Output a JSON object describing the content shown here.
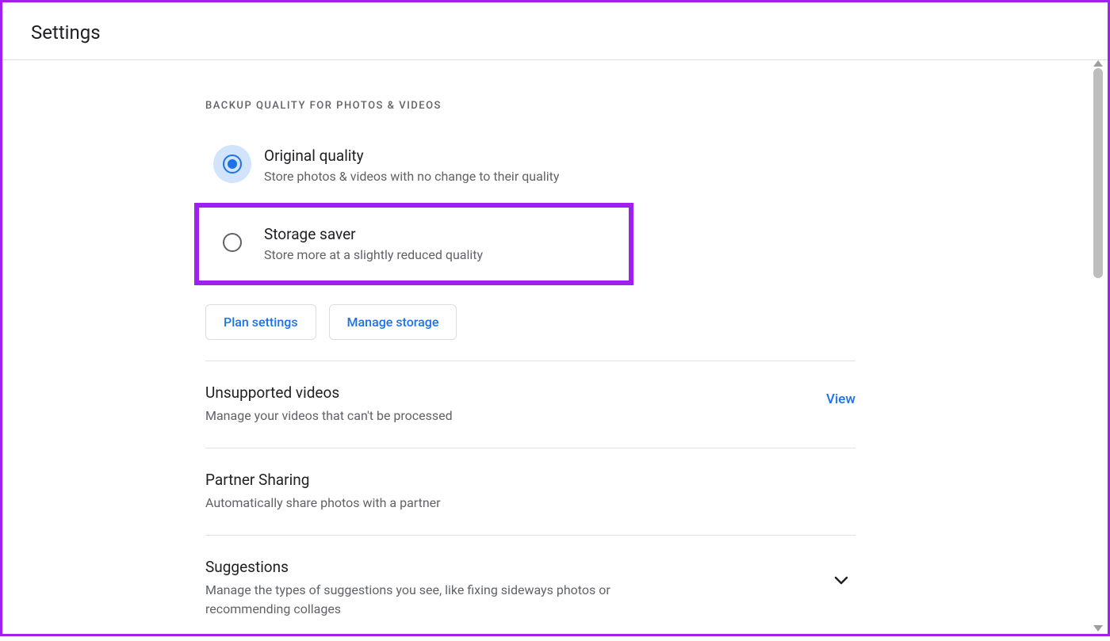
{
  "header": {
    "title": "Settings"
  },
  "backup_quality": {
    "section_label": "BACKUP QUALITY FOR PHOTOS & VIDEOS",
    "options": [
      {
        "title": "Original quality",
        "desc": "Store photos & videos with no change to their quality",
        "selected": true,
        "highlighted": false
      },
      {
        "title": "Storage saver",
        "desc": "Store more at a slightly reduced quality",
        "selected": false,
        "highlighted": true
      }
    ],
    "buttons": {
      "plan": "Plan settings",
      "manage": "Manage storage"
    }
  },
  "sections": {
    "unsupported": {
      "title": "Unsupported videos",
      "desc": "Manage your videos that can't be processed",
      "action_label": "View"
    },
    "partner": {
      "title": "Partner Sharing",
      "desc": "Automatically share photos with a partner"
    },
    "suggestions": {
      "title": "Suggestions",
      "desc": "Manage the types of suggestions you see, like fixing sideways photos or recommending collages"
    }
  }
}
